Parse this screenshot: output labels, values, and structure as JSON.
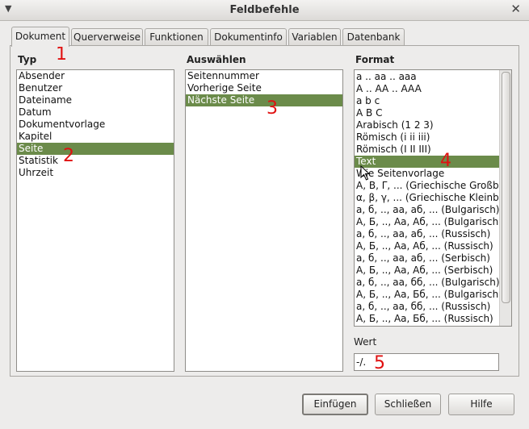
{
  "window": {
    "title": "Feldbefehle"
  },
  "tabs": [
    "Dokument",
    "Querverweise",
    "Funktionen",
    "Dokumentinfo",
    "Variablen",
    "Datenbank"
  ],
  "typ": {
    "header": "Typ",
    "items": [
      "Absender",
      "Benutzer",
      "Dateiname",
      "Datum",
      "Dokumentvorlage",
      "Kapitel",
      "Seite",
      "Statistik",
      "Uhrzeit"
    ],
    "selected": "Seite"
  },
  "auswaehlen": {
    "header": "Auswählen",
    "items": [
      "Seitennummer",
      "Vorherige Seite",
      "Nächste Seite"
    ],
    "selected": "Nächste Seite"
  },
  "format": {
    "header": "Format",
    "items": [
      "a .. aa .. aaa",
      "A .. AA .. AAA",
      "a b c",
      "A B C",
      "Arabisch (1 2 3)",
      "Römisch (i ii iii)",
      "Römisch (I II III)",
      "Text",
      "Wie Seitenvorlage",
      "Α, Β, Γ, ... (Griechische Großb",
      "α, β, γ, ... (Griechische Kleinb",
      "а, б, .., аа, аб, ... (Bulgarisch)",
      "А, Б, .., Аа, Аб, ... (Bulgarisch",
      "а, б, .., аа, аб, ... (Russisch)",
      "А, Б, .., Аа, Аб, ... (Russisch)",
      "а, б, .., аа, аб, ... (Serbisch)",
      "А, Б, .., Аа, Аб, ... (Serbisch)",
      "а, б, .., аа, бб, ... (Bulgarisch)",
      "А, Б, .., Аа, Бб, ... (Bulgarisch)",
      "а, б, .., аа, бб, ... (Russisch)",
      "А, Б, .., Аа, Бб, ... (Russisch)"
    ],
    "selected": "Text"
  },
  "wert": {
    "label": "Wert",
    "value": "-/."
  },
  "buttons": {
    "insert": "Einfügen",
    "close": "Schließen",
    "help": "Hilfe"
  },
  "annotations": [
    "1",
    "2",
    "3",
    "4",
    "5"
  ],
  "icons": {
    "window_menu": "chevron-down-icon",
    "window_close": "close-icon",
    "pointer": "mouse-cursor-icon"
  },
  "colors": {
    "selection": "#6b8b4a",
    "annotation": "#e01010"
  }
}
